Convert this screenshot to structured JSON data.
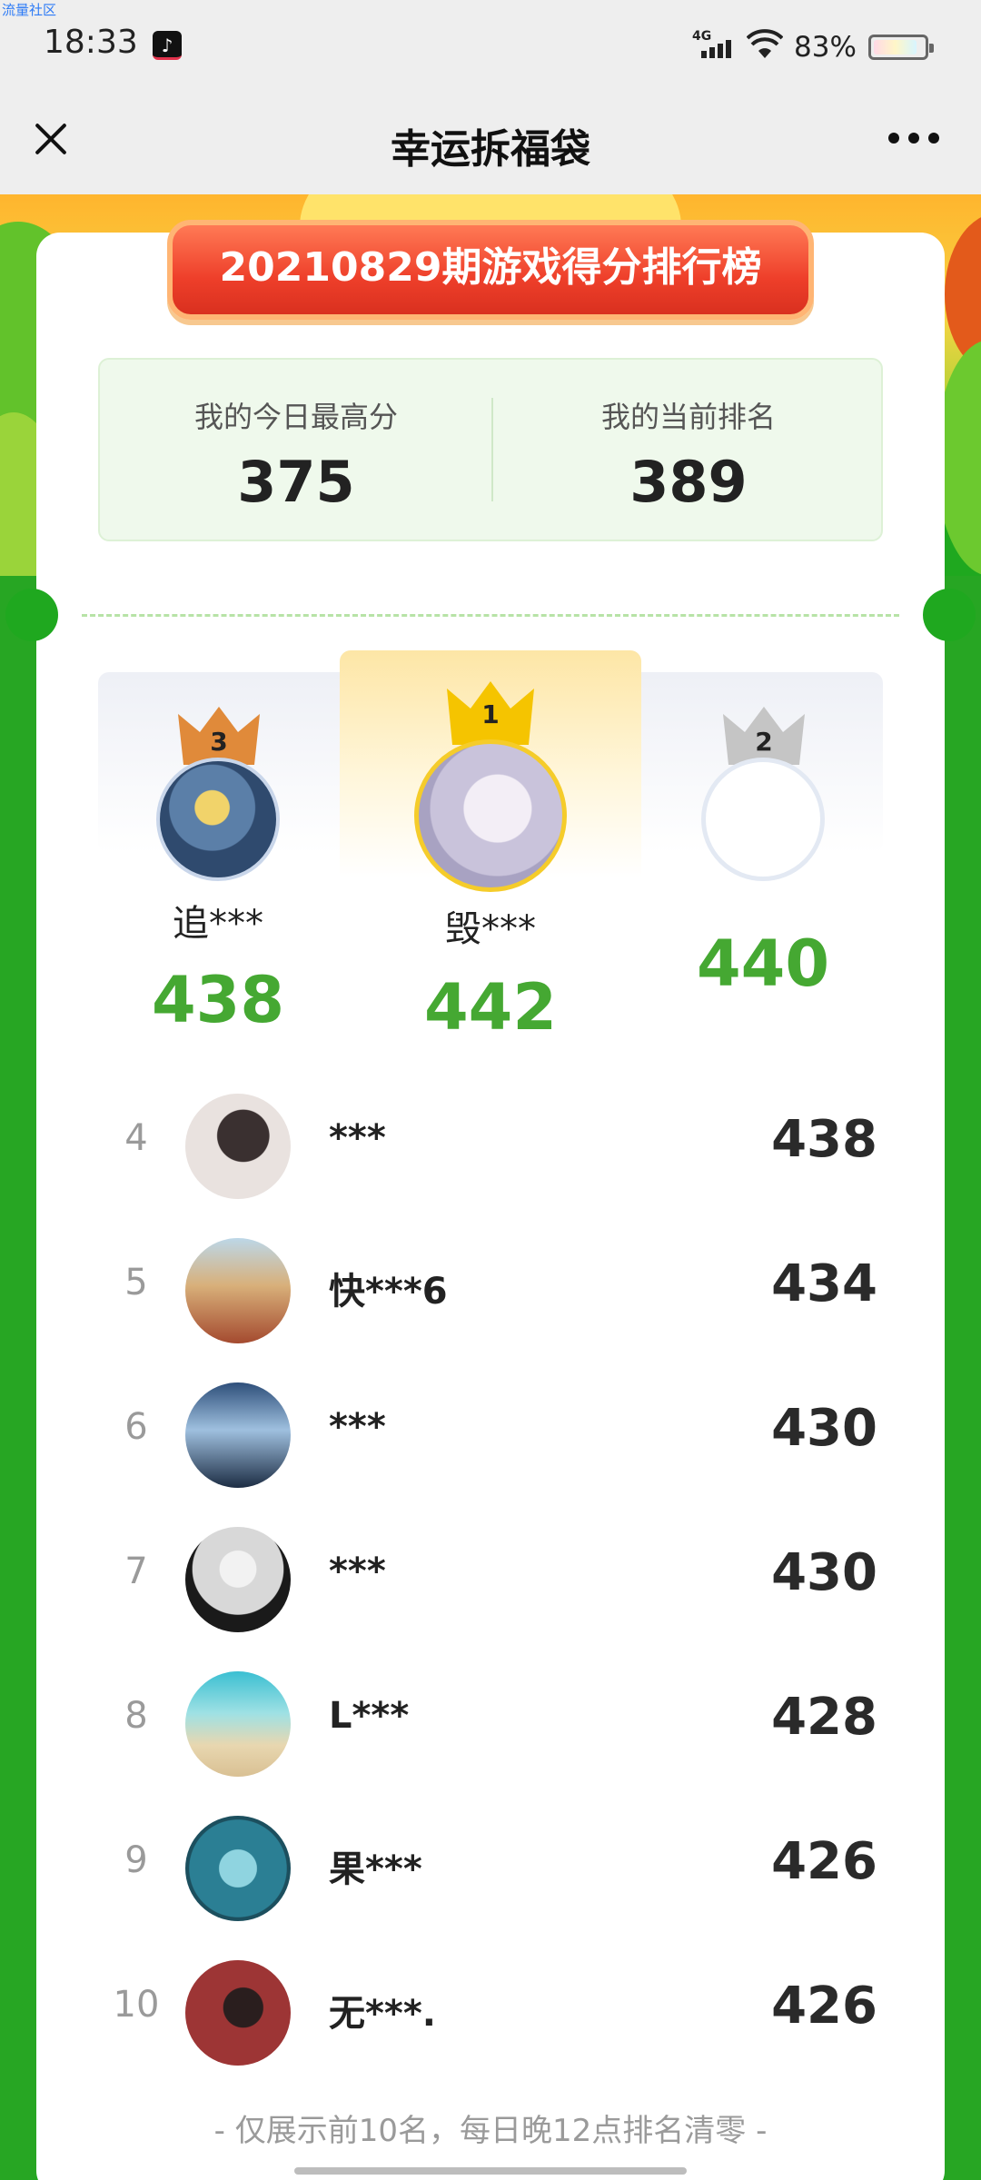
{
  "status_bar": {
    "watermark": "流量社区",
    "time": "18:33",
    "network": "4G",
    "battery": "83%",
    "battery_level": 0.83
  },
  "header": {
    "title": "幸运拆福袋"
  },
  "banner": {
    "title": "20210829期游戏得分排行榜"
  },
  "my_stats": {
    "best_label": "我的今日最高分",
    "best_value": "375",
    "rank_label": "我的当前排名",
    "rank_value": "389"
  },
  "podium": {
    "first": {
      "rank": "1",
      "name": "毁***",
      "score": "442"
    },
    "second": {
      "rank": "2",
      "name": "",
      "score": "440"
    },
    "third": {
      "rank": "3",
      "name": "追***",
      "score": "438"
    }
  },
  "leaderboard": [
    {
      "rank": "4",
      "name": "***",
      "score": "438"
    },
    {
      "rank": "5",
      "name": "快***6",
      "score": "434"
    },
    {
      "rank": "6",
      "name": "***",
      "score": "430"
    },
    {
      "rank": "7",
      "name": "***",
      "score": "430"
    },
    {
      "rank": "8",
      "name": "L***",
      "score": "428"
    },
    {
      "rank": "9",
      "name": "果***",
      "score": "426"
    },
    {
      "rank": "10",
      "name": "无***.",
      "score": "426"
    }
  ],
  "footnote": "- 仅展示前10名，每日晚12点排名清零 -",
  "colors": {
    "brand_green": "#1fa81f",
    "score_green": "#45a832",
    "banner_red": "#ee3f2a",
    "gold": "#fde6a6"
  }
}
